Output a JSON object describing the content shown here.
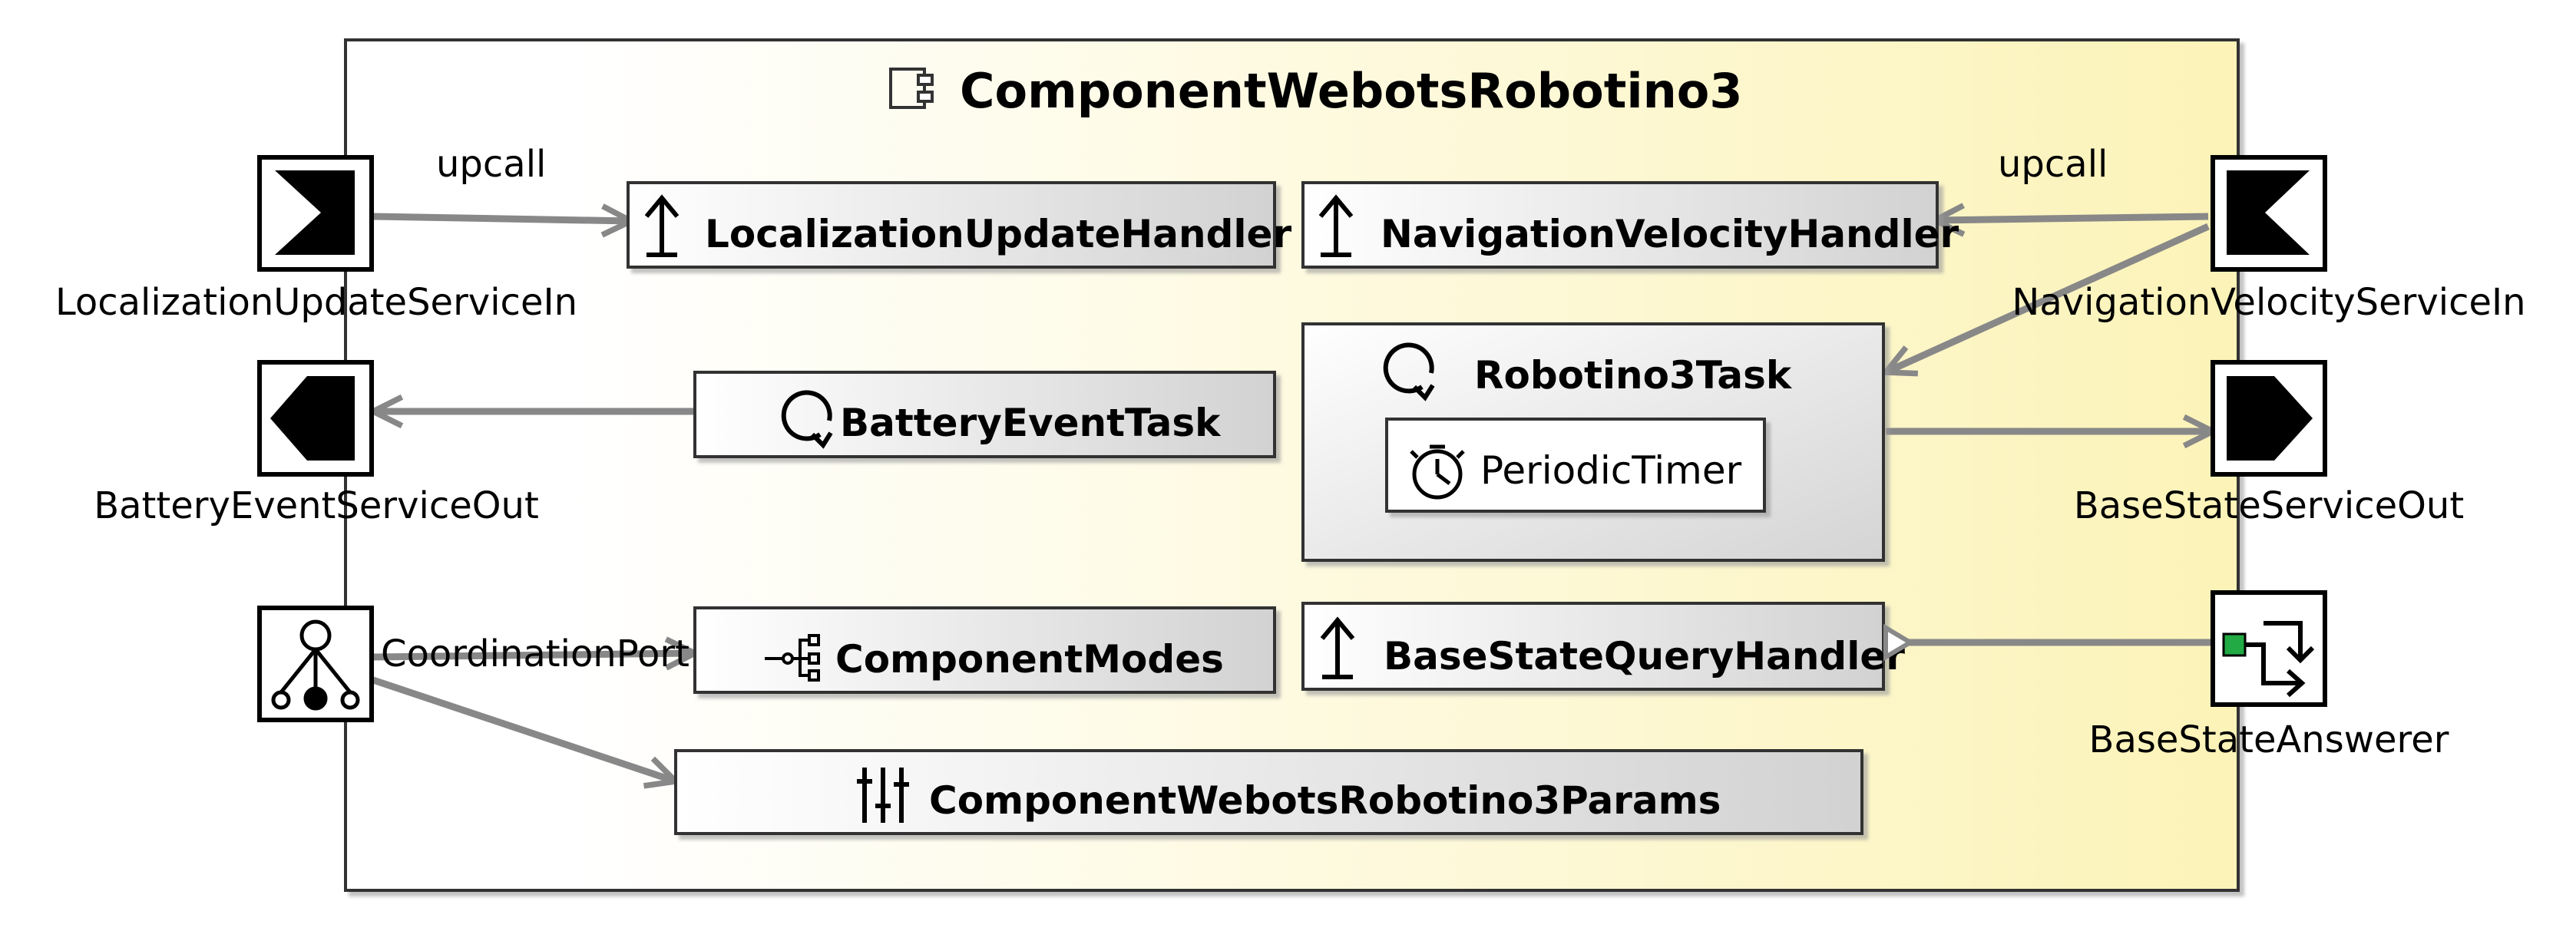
{
  "component": {
    "title": "ComponentWebotsRobotino3",
    "title_icon": "component-icon",
    "fill_start": "#ffffff",
    "fill_end": "#fcf3b8"
  },
  "ports": {
    "localization_update_service_in": {
      "label": "LocalizationUpdateServiceIn",
      "icon": "input-port-icon"
    },
    "navigation_velocity_service_in": {
      "label": "NavigationVelocityServiceIn",
      "icon": "input-port-icon"
    },
    "battery_event_service_out": {
      "label": "BatteryEventServiceOut",
      "icon": "output-port-icon"
    },
    "base_state_service_out": {
      "label": "BaseStateServiceOut",
      "icon": "output-port-icon"
    },
    "coordination_port": {
      "label": "CoordinationPort",
      "icon": "coordination-port-icon"
    },
    "base_state_answerer": {
      "label": "BaseStateAnswerer",
      "icon": "answerer-port-icon"
    }
  },
  "connection_labels": {
    "left_upcall": "upcall",
    "right_upcall": "upcall"
  },
  "elements": {
    "localization_update_handler": {
      "label": "LocalizationUpdateHandler",
      "icon": "upcall-handler-icon"
    },
    "navigation_velocity_handler": {
      "label": "NavigationVelocityHandler",
      "icon": "upcall-handler-icon"
    },
    "battery_event_task": {
      "label": "BatteryEventTask",
      "icon": "task-icon"
    },
    "robotino3_task": {
      "label": "Robotino3Task",
      "icon": "task-icon"
    },
    "periodic_timer": {
      "label": "PeriodicTimer",
      "icon": "timer-icon"
    },
    "component_modes": {
      "label": "ComponentModes",
      "icon": "modes-icon"
    },
    "base_state_query_handler": {
      "label": "BaseStateQueryHandler",
      "icon": "upcall-handler-icon"
    },
    "params": {
      "label": "ComponentWebotsRobotino3Params",
      "icon": "params-icon"
    }
  },
  "colors": {
    "connector": "#888888",
    "box_fill_end": "#d2d2d2",
    "answerer_accent": "#22aa44"
  }
}
